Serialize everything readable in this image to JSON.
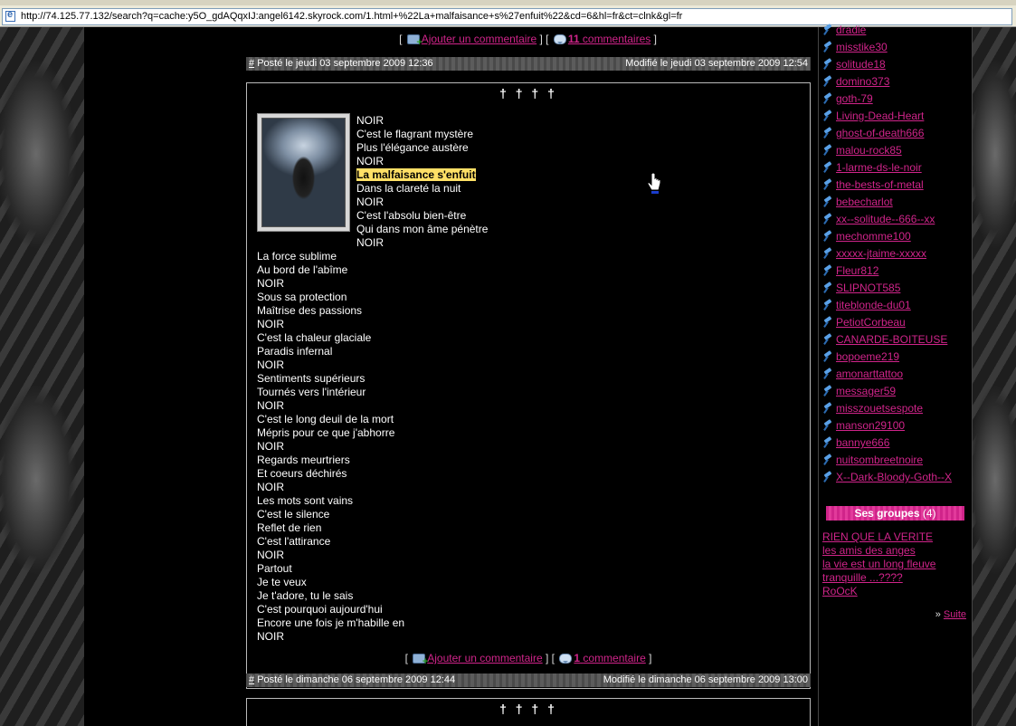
{
  "browser": {
    "url": "http://74.125.77.132/search?q=cache:y5O_gdAQqxIJ:angel6142.skyrock.com/1.html+%22La+malfaisance+s%27enfuit%22&cd=6&hl=fr&ct=clnk&gl=fr"
  },
  "prev_post": {
    "add_comment": "Ajouter un commentaire",
    "comment_count": "11",
    "comment_word": "commentaires",
    "hash": "#",
    "posted": "Posté le jeudi 03 septembre 2009 12:36",
    "modified": "Modifié le jeudi 03 septembre 2009 12:54"
  },
  "post": {
    "title": "† † † †",
    "lines_a": [
      "NOIR",
      "C'est le flagrant mystère",
      "Plus l'élégance austère",
      "NOIR",
      "La malfaisance s'enfuit",
      "Dans la clareté la nuit",
      "NOIR",
      "C'est l'absolu bien-être",
      "Qui dans mon âme pénètre",
      "NOIR"
    ],
    "lines_b": [
      "La force sublime",
      "Au bord de l'abîme",
      "NOIR",
      "Sous sa protection",
      "Maîtrise des passions",
      "NOIR",
      "C'est la chaleur glaciale",
      "Paradis infernal",
      "NOIR",
      "Sentiments supérieurs",
      "Tournés vers l'intérieur",
      "NOIR",
      "C'est le long deuil de la mort",
      "Mépris pour ce que j'abhorre",
      "NOIR",
      "Regards meurtriers",
      "Et coeurs déchirés",
      "NOIR",
      "Les mots sont vains",
      "C'est le silence",
      "Reflet de rien",
      "C'est l'attirance",
      "NOIR",
      "Partout",
      "Je te veux",
      "Je t'adore, tu le sais",
      "C'est pourquoi aujourd'hui",
      "Encore une fois je m'habille en",
      "NOIR"
    ],
    "add_comment": "Ajouter un commentaire",
    "comment_count": "1",
    "comment_word": "commentaire",
    "hash": "#",
    "posted": "Posté le dimanche 06 septembre 2009 12:44",
    "modified": "Modifié le dimanche 06 septembre 2009 13:00"
  },
  "next_post": {
    "title": "† † † †"
  },
  "punct": {
    "open": "[",
    "close": "]",
    "mid": "] ["
  },
  "sidebar": {
    "friends": [
      "dradie",
      "misstike30",
      "solitude18",
      "domino373",
      "goth-79",
      "Living-Dead-Heart",
      "ghost-of-death666",
      "malou-rock85",
      "1-larme-ds-le-noir",
      "the-bests-of-metal",
      "bebecharlot",
      "xx--solitude--666--xx",
      "mechomme100",
      "xxxxx-jtaime-xxxxx",
      "Fleur812",
      "SLIPNOT585",
      "titeblonde-du01",
      "PetiotCorbeau",
      "CANARDE-BOITEUSE",
      "bopoeme219",
      "amonarttattoo",
      "messager59",
      "misszouetsespote",
      "manson29100",
      "bannye666",
      "nuitsombreetnoire",
      "X--Dark-Bloody-Goth--X"
    ],
    "groups_title": "Ses groupes",
    "groups_count": "(4)",
    "groups": [
      "RIEN QUE LA VERITE",
      "les amis des anges",
      "la vie est un long fleuve tranquille ...????",
      "RoOcK"
    ],
    "more_prefix": "»",
    "more_label": "Suite"
  }
}
